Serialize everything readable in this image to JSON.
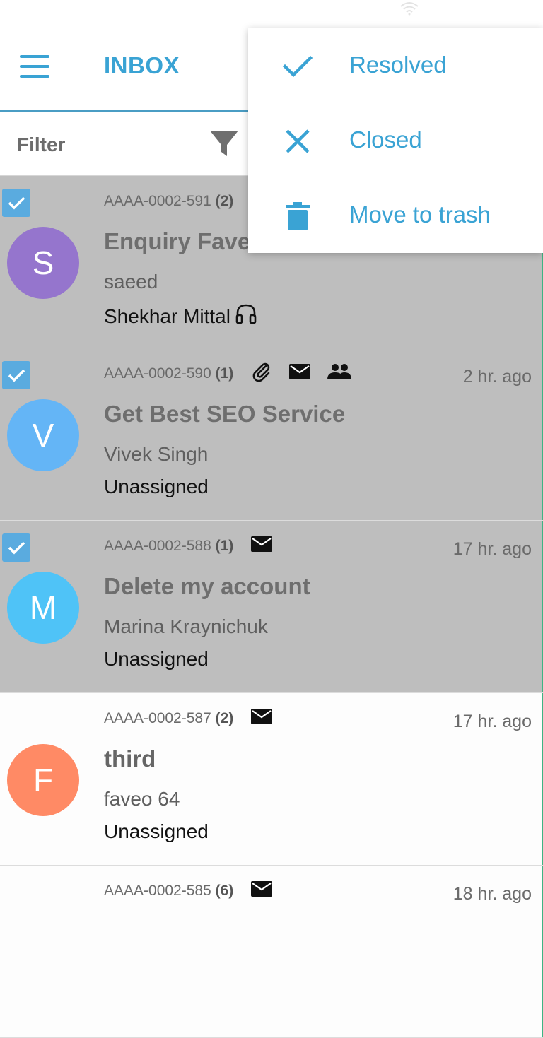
{
  "status_bar": {
    "left_text": "",
    "icons": [
      "wifi-icon"
    ]
  },
  "app_bar": {
    "title": "INBOX",
    "menu_icon": "hamburger-menu-icon"
  },
  "filter": {
    "label": "Filter",
    "icon": "funnel-icon"
  },
  "popup_menu": [
    {
      "label": "Resolved",
      "icon": "check-icon"
    },
    {
      "label": "Closed",
      "icon": "close-icon"
    },
    {
      "label": "Move to trash",
      "icon": "trash-icon"
    }
  ],
  "tickets": [
    {
      "id": "AAAA-0002-591",
      "count": "(2)",
      "time": "",
      "subject": "Enquiry Fave",
      "from": "saeed",
      "assignee": "Shekhar Mittal",
      "avatar": "S",
      "avatar_color": "#9575cd",
      "selected": true,
      "icons": []
    },
    {
      "id": "AAAA-0002-590",
      "count": "(1)",
      "time": "2 hr. ago",
      "subject": "Get Best SEO Service",
      "from": "Vivek Singh",
      "assignee": "Unassigned",
      "avatar": "V",
      "avatar_color": "#64b5f6",
      "selected": true,
      "icons": [
        "attachment-icon",
        "mail-icon",
        "people-icon"
      ]
    },
    {
      "id": "AAAA-0002-588",
      "count": "(1)",
      "time": "17 hr. ago",
      "subject": "Delete my account",
      "from": "Marina Kraynichuk",
      "assignee": "Unassigned",
      "avatar": "M",
      "avatar_color": "#4fc3f7",
      "selected": true,
      "icons": [
        "mail-icon"
      ]
    },
    {
      "id": "AAAA-0002-587",
      "count": "(2)",
      "time": "17 hr. ago",
      "subject": "third",
      "from": "faveo 64",
      "assignee": "Unassigned",
      "avatar": "F",
      "avatar_color": "#ff8a65",
      "selected": false,
      "icons": [
        "mail-icon"
      ]
    },
    {
      "id": "AAAA-0002-585",
      "count": "(6)",
      "time": "18 hr. ago",
      "subject": "",
      "from": "",
      "assignee": "",
      "avatar": "",
      "avatar_color": "#ffffff",
      "selected": false,
      "icons": [
        "mail-icon"
      ]
    }
  ],
  "colors": {
    "accent": "#3aa3d4",
    "selected_row": "#bebebe",
    "checkbox": "#5aabdf",
    "divider_green": "#3db483"
  }
}
